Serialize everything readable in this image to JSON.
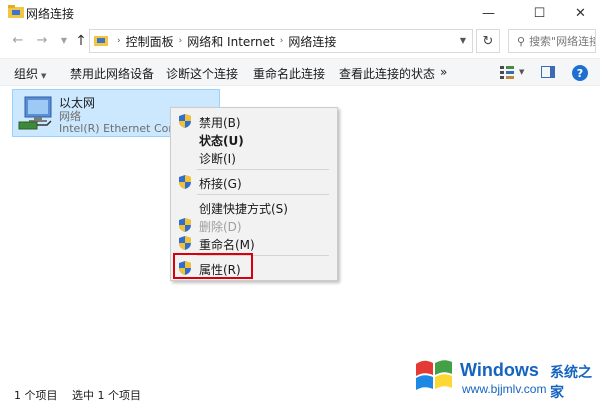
{
  "window": {
    "title": "网络连接",
    "minimize_glyph": "—",
    "maximize_glyph": "☐",
    "close_glyph": "✕"
  },
  "address": {
    "breadcrumbs": [
      "控制面板",
      "网络和 Internet",
      "网络连接"
    ],
    "search_placeholder": "搜索\"网络连接\""
  },
  "toolbar": {
    "organize": "组织",
    "disable_device": "禁用此网络设备",
    "diagnose": "诊断这个连接",
    "rename": "重命名此连接",
    "view_status": "查看此连接的状态",
    "more": "»",
    "help": "?"
  },
  "connection": {
    "name": "以太网",
    "status": "网络",
    "device": "Intel(R) Ethernet Conne..."
  },
  "context_menu": {
    "items": [
      {
        "label": "禁用(B)"
      },
      {
        "label": "状态(U)"
      },
      {
        "label": "诊断(I)"
      },
      {
        "label": "桥接(G)"
      },
      {
        "label": "创建快捷方式(S)"
      },
      {
        "label": "删除(D)"
      },
      {
        "label": "重命名(M)"
      },
      {
        "label": "属性(R)"
      }
    ]
  },
  "statusbar": {
    "item_count": "1 个项目",
    "selected": "选中 1 个项目"
  },
  "watermark": {
    "brand": "Windows",
    "brand_cn": "系统之家",
    "url": "www.bjjmlv.com"
  },
  "colors": {
    "selection_fill": "#cce8ff",
    "selection_border": "#99d1ff",
    "highlight_box": "#d8000c",
    "help_blue": "#1f6fd1",
    "watermark_blue": "#1565c0"
  },
  "icons": {
    "app": "network-folder-icon",
    "back": "arrow-left-icon",
    "forward": "arrow-right-icon",
    "up": "arrow-up-icon",
    "refresh": "refresh-icon",
    "search": "search-icon",
    "shield": "uac-shield-icon",
    "connection": "ethernet-adapter-icon"
  }
}
